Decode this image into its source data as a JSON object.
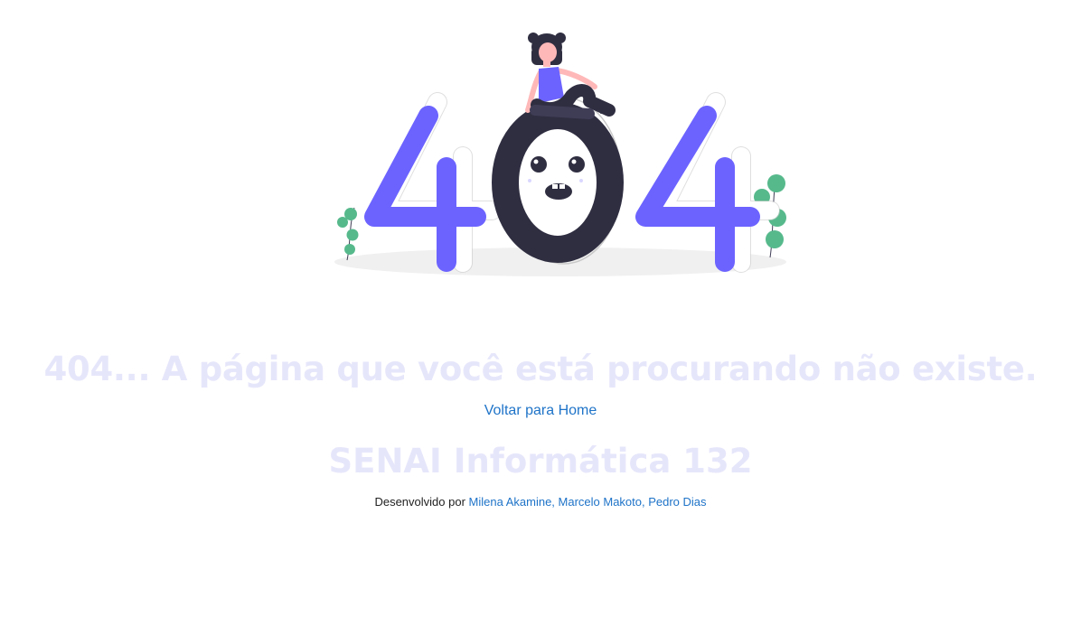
{
  "page": {
    "headline": "404... A página que você está procurando não existe.",
    "home_link": "Voltar para Home",
    "brand": "SENAI Informática 132",
    "credits_prefix": "Desenvolvido por",
    "credits_authors": "Milena Akamine, Marcelo Makoto, Pedro Dias"
  },
  "colors": {
    "accent": "#6c63ff",
    "dark": "#2f2e41",
    "plant": "#56b98c",
    "link": "#1e73c8",
    "faded_heading": "#e6e6fb"
  },
  "icons": {
    "illustration": "404-illustration"
  }
}
